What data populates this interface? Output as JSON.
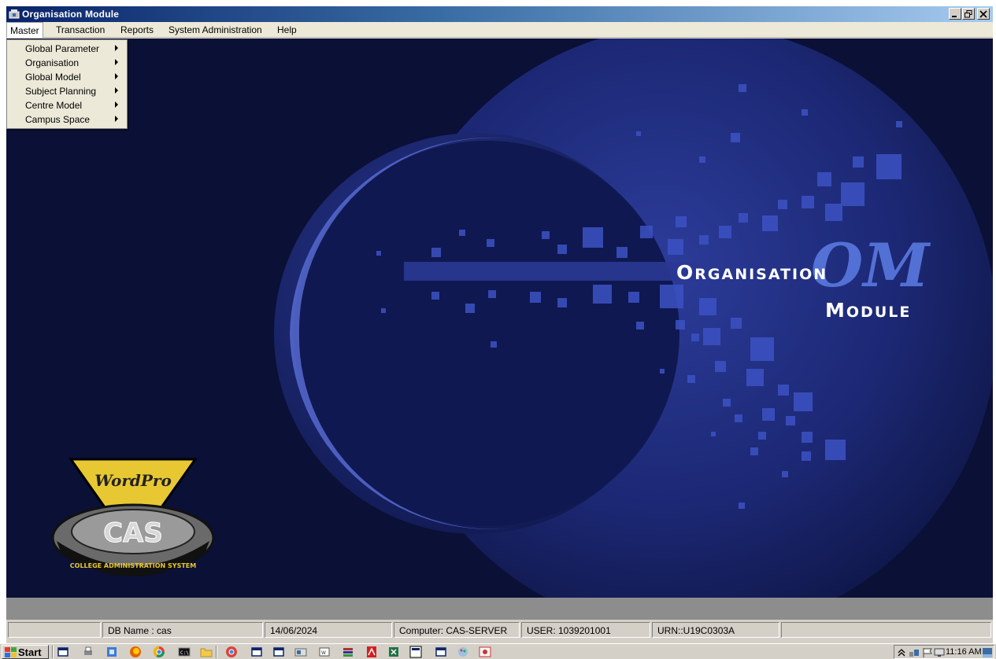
{
  "window": {
    "title": "Organisation Module"
  },
  "menubar": {
    "items": [
      {
        "label": "Master"
      },
      {
        "label": "Transaction"
      },
      {
        "label": "Reports"
      },
      {
        "label": "System Administration"
      },
      {
        "label": "Help"
      }
    ]
  },
  "master_menu": {
    "items": [
      {
        "label": "Global Parameter"
      },
      {
        "label": "Organisation"
      },
      {
        "label": "Global Model"
      },
      {
        "label": "Subject Planning"
      },
      {
        "label": "Centre Model"
      },
      {
        "label": "Campus Space"
      }
    ]
  },
  "splash": {
    "line1_first": "O",
    "line1_rest": "RGANISATION",
    "line2_first": "M",
    "line2_rest": "ODULE",
    "mark": "OM",
    "logo": {
      "brand": "WordPro",
      "name": "CAS",
      "tagline": "COLLEGE ADMINISTRATION SYSTEM"
    }
  },
  "statusbar": {
    "panel0": "",
    "db_name": "DB Name : cas",
    "date": "14/06/2024",
    "computer": "Computer: CAS-SERVER",
    "user": "USER: 1039201001",
    "urn": "URN::U19C0303A",
    "panel6": ""
  },
  "taskbar": {
    "start_label": "Start",
    "clock": "11:16 AM"
  },
  "colors": {
    "titlebar_start": "#0a246a",
    "background": "#0b1036",
    "accent": "#5d7de6"
  }
}
